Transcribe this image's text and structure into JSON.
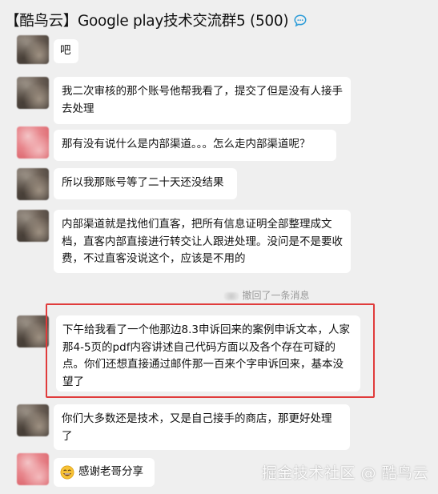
{
  "header": {
    "title": "【酷鸟云】Google play技术交流群5 (500)",
    "icon": "chat-bubble-icon"
  },
  "messages": [
    {
      "text": "吧"
    },
    {
      "text": "我二次审核的那个账号他帮我看了，提交了但是没有人接手去处理"
    },
    {
      "text": "那有没有说什么是内部渠道。。。怎么走内部渠道呢？"
    },
    {
      "text": "所以我那账号等了二十天还没结果"
    },
    {
      "text": "内部渠道就是找他们直客，把所有信息证明全部整理成文档，直客内部直接进行转交让人跟进处理。没问是不是要收费，不过直客没说这个，应该是不用的"
    },
    {
      "text": "下午给我看了一个他那边8.3申诉回来的案例申诉文本，人家那4-5页的pdf内容讲述自己代码方面以及各个存在可疑的点。你们还想直接通过邮件那一百来个字申诉回来，基本没望了"
    },
    {
      "text": "你们大多数还是技术，又是自己接手的商店，那更好处理了"
    },
    {
      "text": "感谢老哥分享",
      "emoji": "grinning-face-emoji"
    }
  ],
  "system": {
    "recall_text": "撤回了一条消息"
  },
  "watermark": {
    "text": "掘金技术社区 @ 酷鸟云"
  },
  "colors": {
    "background": "#efefef",
    "bubble": "#ffffff",
    "highlight": "#e03b3b"
  }
}
